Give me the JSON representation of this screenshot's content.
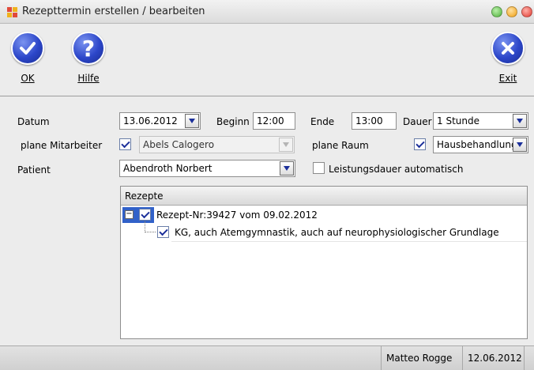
{
  "window": {
    "title": "Rezepttermin erstellen / bearbeiten",
    "colors": {
      "close": "#e8413a",
      "minimize": "#f2a71b",
      "maximize": "#5fc04b"
    }
  },
  "toolbar": {
    "ok_label": "OK",
    "help_label": "Hilfe",
    "exit_label": "Exit",
    "colors": {
      "button_fill": "#2c46c9"
    }
  },
  "form": {
    "datum_label": "Datum",
    "datum_value": "13.06.2012",
    "beginn_label": "Beginn",
    "beginn_value": "12:00",
    "ende_label": "Ende",
    "ende_value": "13:00",
    "dauer_label": "Dauer",
    "dauer_value": "1 Stunde",
    "mitarbeiter_label": "plane Mitarbeiter",
    "mitarbeiter_checked": true,
    "mitarbeiter_value": "Abels Calogero",
    "raum_label": "plane Raum",
    "raum_checked": true,
    "raum_value": "Hausbehandlung",
    "patient_label": "Patient",
    "patient_value": "Abendroth Norbert",
    "leistungsdauer_label": "Leistungsdauer automatisch",
    "leistungsdauer_checked": false
  },
  "tree": {
    "header": "Rezepte",
    "rows": [
      {
        "label": "Rezept-Nr:39427 vom 09.02.2012",
        "checked": true,
        "expanded": true
      },
      {
        "label": "KG, auch Atemgymnastik, auch auf neurophysiologischer Grundlage",
        "checked": true
      }
    ],
    "colors": {
      "selection": "#3161c9"
    }
  },
  "status": {
    "user": "Matteo Rogge",
    "date": "12.06.2012"
  }
}
